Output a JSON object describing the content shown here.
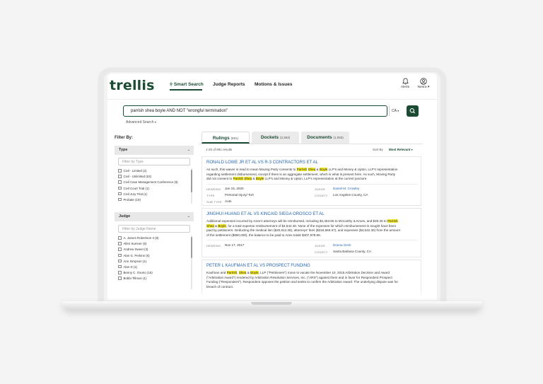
{
  "app": {
    "logo": "trellis",
    "nav": [
      {
        "label": "Smart Search",
        "icon": "search-icon",
        "active": true
      },
      {
        "label": "Judge Reports",
        "active": false
      },
      {
        "label": "Motions & Issues",
        "active": false
      }
    ],
    "alerts_label": "Alerts",
    "user_label": "Nesra"
  },
  "search": {
    "query": "parrish shea boyle AND NOT \"wrongful termination\"",
    "state": "CA",
    "advanced_label": "Advanced Search"
  },
  "filters": {
    "title": "Filter By:",
    "type": {
      "label": "Type",
      "placeholder": "Filter by Type",
      "items": [
        "Civil - Limited (2)",
        "Civil - Unlimited (63)",
        "Civil Case Management Conference (8)",
        "Civil Court Trial (1)",
        "Civil Jury Trial (1)",
        "Probate (19)"
      ]
    },
    "judge": {
      "label": "Judge",
      "placeholder": "Filter by Judge Name",
      "items": [
        "A. James Robertson II (9)",
        "Allen Sumner (6)",
        "Andrew Sweet (3)",
        "Alan G. Perkins (6)",
        "Ann Simpson (1)",
        "Alan D (1)",
        "Benny C. Osorio (16)",
        "Bobbi Tillmon (1)"
      ]
    }
  },
  "tabs": [
    {
      "label": "Rulings",
      "count": "(691)",
      "active": true
    },
    {
      "label": "Dockets",
      "count": "(3,363)",
      "active": false
    },
    {
      "label": "Documents",
      "count": "(1,093)",
      "active": false
    }
  ],
  "results_meta": {
    "count_text": "1-25 of 691 results",
    "sort_label": "Sort By",
    "sort_value": "Most Relevant"
  },
  "results": [
    {
      "title": "RONALD LOWE JR ET AL VS R-3 CONTRACTORS ET AL",
      "snippet": [
        [
          {
            "t": "As such, this waiver is read to mean Moving Party consents to "
          },
          {
            "t": "Parrish",
            "hl": true
          },
          {
            "t": " "
          },
          {
            "t": "Shea",
            "hl": true
          },
          {
            "t": " & "
          },
          {
            "t": "Boyle",
            "hl": true
          },
          {
            "t": " LLP's and Money & Upton, LLP's representation"
          }
        ],
        [
          {
            "t": "regarding settlement disbursement, except if there is an aggregate settlement, which is what is present here. As such, Moving Party"
          }
        ],
        [
          {
            "t": "did not consent to "
          },
          {
            "t": "Parrish",
            "hl": true
          },
          {
            "t": " "
          },
          {
            "t": "Shea",
            "hl": true
          },
          {
            "t": " & "
          },
          {
            "t": "Boyle",
            "hl": true
          },
          {
            "t": " LLP's and Money & Upton, LLP's representation at the current juncture."
          }
        ]
      ],
      "hearing_label": "HEARING",
      "hearing": "Jan 15, 2020",
      "judge_label": "JUDGE",
      "judge": "Daniel M. Crowley",
      "type_label": "TYPE",
      "type": "Personal Injury/ Tort",
      "county_label": "COUNTY",
      "county": "Los Angeles County, CA",
      "subtype_label": "SUB TYPE",
      "subtype": "Auto"
    },
    {
      "title": "JINGHUI HUANG ET AL VS KINCAID SIEGA OROSCO ET AL",
      "snippet": [
        [
          {
            "t": "Additional expenses incurred by Azex's attorneys will be reimbursed, including $4,453.65 to McCarthy & Kroes, and $49.25 to "
          },
          {
            "t": "Parrish",
            "hl": true
          }
        ],
        [
          {
            "t": "Shea",
            "hl": true
          },
          {
            "t": " & "
          },
          {
            "t": "Boyle",
            "hl": true
          },
          {
            "t": ", for a total expense reimbursement of $4,542.30. None of the expenses for which reimbursement is sought have been"
          }
        ],
        [
          {
            "t": "paid by petitioners. Deducting the medical lien ($20,812.38), attorneys' fees ($216,666.67), and expenses ($4,542.30) from the amount"
          }
        ],
        [
          {
            "t": "of the settlement ($650,000), the balance to be paid to Azex totals $407,978.95."
          }
        ]
      ],
      "hearing_label": "HEARING",
      "hearing": "Nov 17, 2017",
      "judge_label": "JUDGE",
      "judge": "Donna Geck",
      "county_label": "COUNTY",
      "county": "Santa Barbara County, CA"
    },
    {
      "title": "PETER L KAUFMAN ET AL VS PROSPECT FUNDING",
      "snippet": [
        [
          {
            "t": "Kaufman and "
          },
          {
            "t": "Parrish",
            "hl": true
          },
          {
            "t": ", "
          },
          {
            "t": "Shea",
            "hl": true
          },
          {
            "t": " & "
          },
          {
            "t": "Boyle",
            "hl": true
          },
          {
            "t": ", LLP (\"Petitioners\") move to vacate the November 10, 2016 Arbitration Decision and Award"
          }
        ],
        [
          {
            "t": "(\"Arbitration Award\") rendered by Arbitration Resolution Services, Inc. (\"ARS\") against them and in favor for Respondent Prospect"
          }
        ],
        [
          {
            "t": "Funding (\"Respondent\"). Respondent opposes the petition and seeks to confirm the Arbitration Award. The underlying dispute was for"
          }
        ],
        [
          {
            "t": "breach of contract."
          }
        ]
      ]
    }
  ],
  "colors": {
    "brand": "#1c4b33",
    "link": "#2667b3",
    "highlight": "#f5ea2a"
  }
}
